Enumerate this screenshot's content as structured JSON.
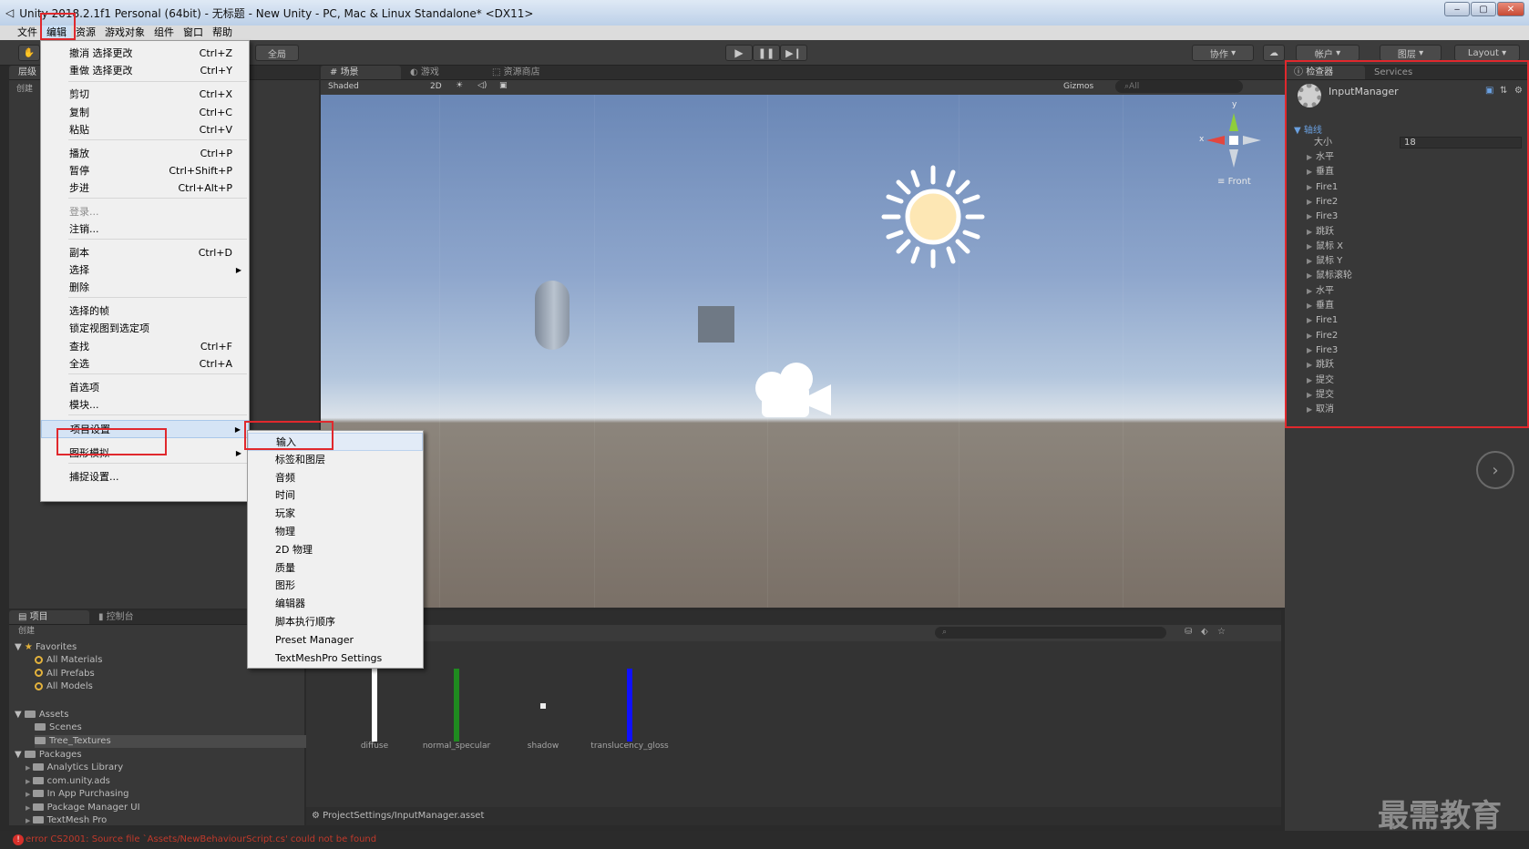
{
  "window": {
    "title": "Unity 2018.2.1f1 Personal (64bit) - 无标题 - New Unity - PC, Mac & Linux Standalone* <DX11>"
  },
  "menubar": [
    "文件",
    "编辑",
    "资源",
    "游戏对象",
    "组件",
    "窗口",
    "帮助"
  ],
  "toolbar": {
    "global_label": "全局",
    "collab_label": "协作",
    "account_label": "帐户",
    "layers_label": "图层",
    "layout_label": "Layout"
  },
  "left_panel": {
    "tab": "层级",
    "create_label": "创建"
  },
  "scene_tabs": [
    "场景",
    "游戏",
    "资源商店"
  ],
  "scene_toolbar": {
    "shading": "Shaded",
    "mode_2d": "2D",
    "gizmos": "Gizmos",
    "search_placeholder": "All"
  },
  "scene": {
    "view_label": "Front",
    "axis_x": "x",
    "axis_y": "y"
  },
  "edit_menu": [
    {
      "label": "撤消 选择更改",
      "shortcut": "Ctrl+Z"
    },
    {
      "label": "重做 选择更改",
      "shortcut": "Ctrl+Y"
    },
    {
      "label": "剪切",
      "shortcut": "Ctrl+X"
    },
    {
      "label": "复制",
      "shortcut": "Ctrl+C"
    },
    {
      "label": "粘贴",
      "shortcut": "Ctrl+V"
    },
    {
      "label": "播放",
      "shortcut": "Ctrl+P"
    },
    {
      "label": "暂停",
      "shortcut": "Ctrl+Shift+P"
    },
    {
      "label": "步进",
      "shortcut": "Ctrl+Alt+P"
    },
    {
      "label": "登录..."
    },
    {
      "label": "注销..."
    },
    {
      "label": "副本",
      "shortcut": "Ctrl+D"
    },
    {
      "label": "选择"
    },
    {
      "label": "删除"
    },
    {
      "label": "选择的帧"
    },
    {
      "label": "锁定视图到选定项"
    },
    {
      "label": "查找",
      "shortcut": "Ctrl+F"
    },
    {
      "label": "全选",
      "shortcut": "Ctrl+A"
    },
    {
      "label": "首选项"
    },
    {
      "label": "模块..."
    },
    {
      "label": "项目设置"
    },
    {
      "label": "图形模拟"
    },
    {
      "label": "捕捉设置..."
    }
  ],
  "project_settings_menu": [
    "输入",
    "标签和图层",
    "音频",
    "时间",
    "玩家",
    "物理",
    "2D 物理",
    "质量",
    "图形",
    "编辑器",
    "脚本执行顺序",
    "Preset Manager",
    "TextMeshPro Settings"
  ],
  "inspector": {
    "tabs": [
      "检查器",
      "Services"
    ],
    "object_name": "InputManager",
    "axes_label": "轴线",
    "size_label": "大小",
    "size_value": "18",
    "axes": [
      "水平",
      "垂直",
      "Fire1",
      "Fire2",
      "Fire3",
      "跳跃",
      "鼠标 X",
      "鼠标 Y",
      "鼠标滚轮",
      "水平",
      "垂直",
      "Fire1",
      "Fire2",
      "Fire3",
      "跳跃",
      "提交",
      "提交",
      "取消"
    ]
  },
  "bottom_tabs": [
    "项目",
    "控制台"
  ],
  "project": {
    "create_label": "创建",
    "favorites_label": "Favorites",
    "favorites": [
      "All Materials",
      "All Prefabs",
      "All Models"
    ],
    "assets_label": "Assets",
    "assets": [
      "Scenes",
      "Tree_Textures"
    ],
    "packages_label": "Packages",
    "packages": [
      "Analytics Library",
      "com.unity.ads",
      "In App Purchasing",
      "Package Manager UI",
      "TextMesh Pro"
    ]
  },
  "textures": [
    {
      "name": "diffuse",
      "color": "#ffffff"
    },
    {
      "name": "normal_specular",
      "color": "#1f8a1f"
    },
    {
      "name": "shadow",
      "color": "#eeeeee"
    },
    {
      "name": "translucency_gloss",
      "color": "#1010ff"
    }
  ],
  "asset_path": "ProjectSettings/InputManager.asset",
  "status": {
    "error": "error CS2001: Source file `Assets/NewBehaviourScript.cs' could not be found"
  },
  "watermark": "最需教育"
}
